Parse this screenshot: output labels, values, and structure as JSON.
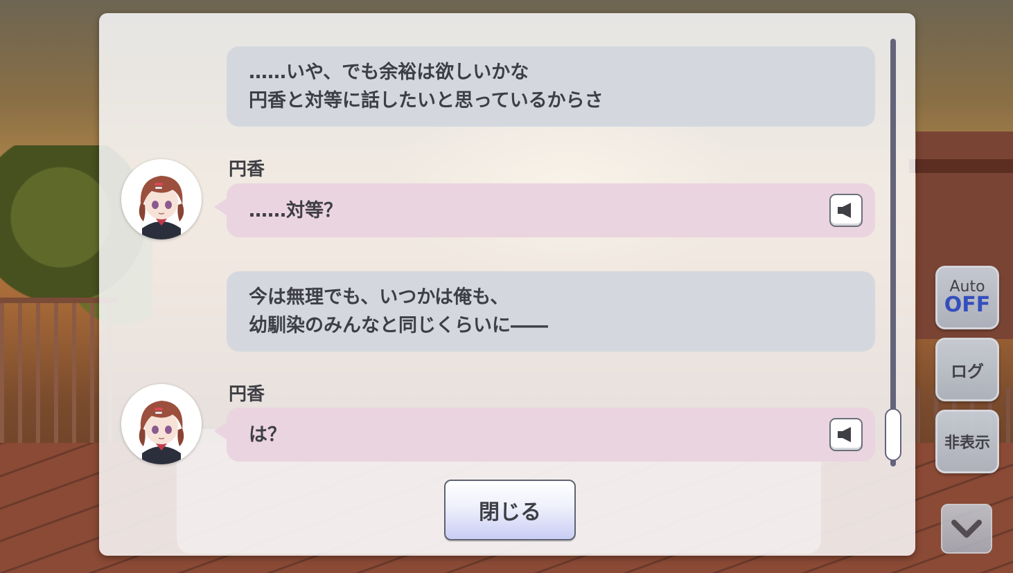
{
  "log": {
    "entries": [
      {
        "type": "narration",
        "lines": [
          "……いや、でも余裕は欲しいかな",
          "円香と対等に話したいと思っているからさ"
        ]
      },
      {
        "type": "character",
        "speaker": "円香",
        "text": "……対等？",
        "voice_icon": "speaker-icon"
      },
      {
        "type": "narration",
        "lines": [
          "今は無理でも、いつかは俺も、",
          "幼馴染のみんなと同じくらいに――"
        ]
      },
      {
        "type": "character",
        "speaker": "円香",
        "text": "は？",
        "voice_icon": "speaker-icon"
      }
    ],
    "close_label": "閉じる"
  },
  "side_controls": {
    "auto_label": "Auto",
    "auto_state": "OFF",
    "log_label": "ログ",
    "hide_label": "非表示",
    "scroll_icon": "chevron-down-icon"
  },
  "colors": {
    "narration_bubble": "#d4d8de",
    "character_bubble": "#ead4df",
    "auto_off": "#2f4fc9"
  }
}
